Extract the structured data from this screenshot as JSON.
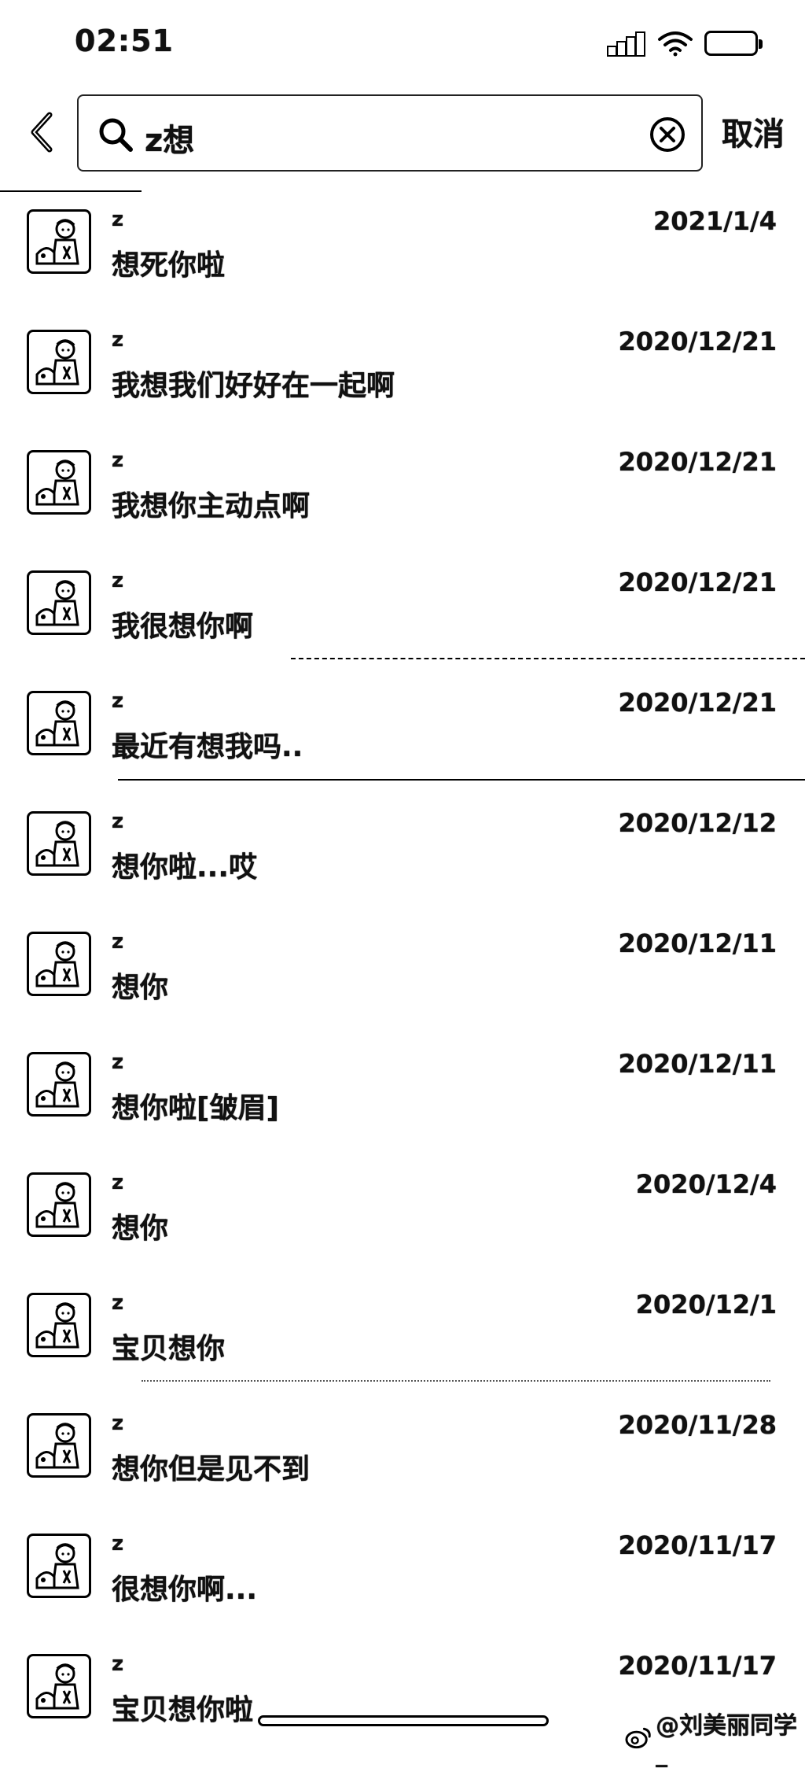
{
  "status_bar": {
    "time": "02:51"
  },
  "search": {
    "query": "z想",
    "cancel_label": "取消"
  },
  "results": [
    {
      "name": "z",
      "date": "2021/1/4",
      "message": "想死你啦"
    },
    {
      "name": "z",
      "date": "2020/12/21",
      "message": "我想我们好好在一起啊"
    },
    {
      "name": "z",
      "date": "2020/12/21",
      "message": "我想你主动点啊"
    },
    {
      "name": "z",
      "date": "2020/12/21",
      "message": "我很想你啊"
    },
    {
      "name": "z",
      "date": "2020/12/21",
      "message": "最近有想我吗.."
    },
    {
      "name": "z",
      "date": "2020/12/12",
      "message": "想你啦...哎"
    },
    {
      "name": "z",
      "date": "2020/12/11",
      "message": "想你"
    },
    {
      "name": "z",
      "date": "2020/12/11",
      "message": "想你啦[皱眉]"
    },
    {
      "name": "z",
      "date": "2020/12/4",
      "message": "想你"
    },
    {
      "name": "z",
      "date": "2020/12/1",
      "message": "宝贝想你"
    },
    {
      "name": "z",
      "date": "2020/11/28",
      "message": "想你但是见不到"
    },
    {
      "name": "z",
      "date": "2020/11/17",
      "message": "很想你啊..."
    },
    {
      "name": "z",
      "date": "2020/11/17",
      "message": "宝贝想你啦"
    }
  ],
  "watermark": "@刘美丽同学_",
  "icons": {
    "back": "chevron-left-icon",
    "search": "search-icon",
    "clear": "clear-circle-icon",
    "signal": "signal-icon",
    "wifi": "wifi-icon",
    "battery": "battery-icon",
    "avatar": "cartoon-avatar-icon",
    "weibo": "weibo-logo-icon"
  }
}
